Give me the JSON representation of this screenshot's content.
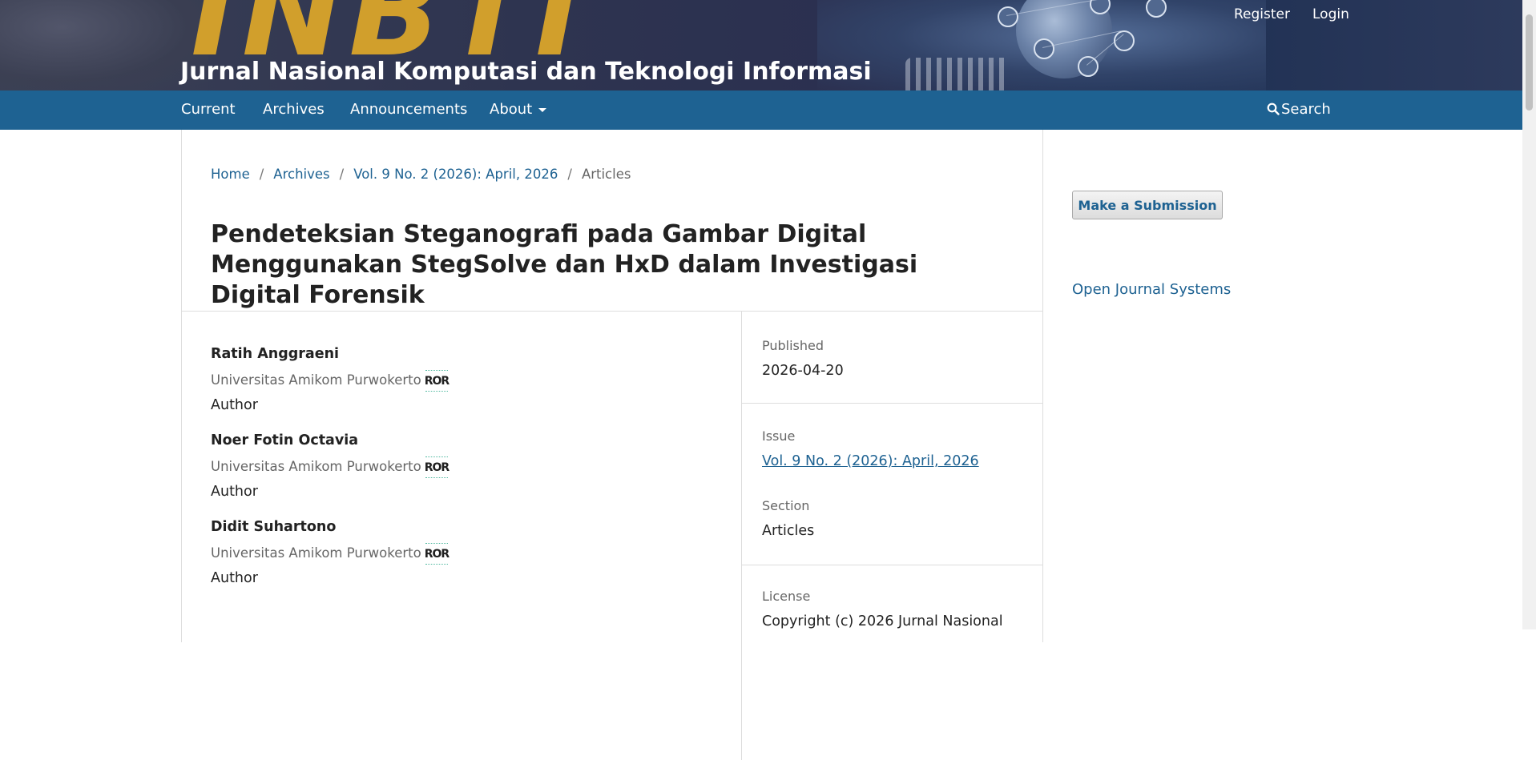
{
  "header": {
    "logo_text": "INBTI",
    "site_title": "Jurnal Nasional Komputasi dan Teknologi Informasi",
    "user_nav": {
      "register": "Register",
      "login": "Login"
    }
  },
  "nav": {
    "items": [
      {
        "label": "Current"
      },
      {
        "label": "Archives"
      },
      {
        "label": "Announcements"
      },
      {
        "label": "About"
      }
    ],
    "search_label": "Search"
  },
  "breadcrumb": {
    "items": [
      "Home",
      "Archives",
      "Vol. 9 No. 2 (2026): April, 2026"
    ],
    "current": "Articles",
    "separator": "/"
  },
  "article": {
    "title": "Pendeteksian Steganografi pada Gambar Digital Menggunakan StegSolve dan HxD dalam Investigasi Digital Forensik",
    "authors": [
      {
        "name": "Ratih Anggraeni",
        "affiliation": "Universitas Amikom Purwokerto",
        "ror": "ROR",
        "role": "Author"
      },
      {
        "name": "Noer Fotin Octavia",
        "affiliation": "Universitas Amikom Purwokerto",
        "ror": "ROR",
        "role": "Author"
      },
      {
        "name": "Didit Suhartono",
        "affiliation": "Universitas Amikom Purwokerto",
        "ror": "ROR",
        "role": "Author"
      }
    ],
    "details": {
      "published_label": "Published",
      "published_value": "2026-04-20",
      "issue_label": "Issue",
      "issue_value": "Vol. 9 No. 2 (2026): April, 2026",
      "section_label": "Section",
      "section_value": "Articles",
      "license_label": "License",
      "license_value": "Copyright (c) 2026 Jurnal Nasional"
    }
  },
  "sidebar": {
    "submit_label": "Make a Submission",
    "ojs_label": "Open Journal Systems"
  },
  "colors": {
    "nav_bg": "#1e6292",
    "link": "#1e6292",
    "logo_gold": "#d19f2c"
  }
}
